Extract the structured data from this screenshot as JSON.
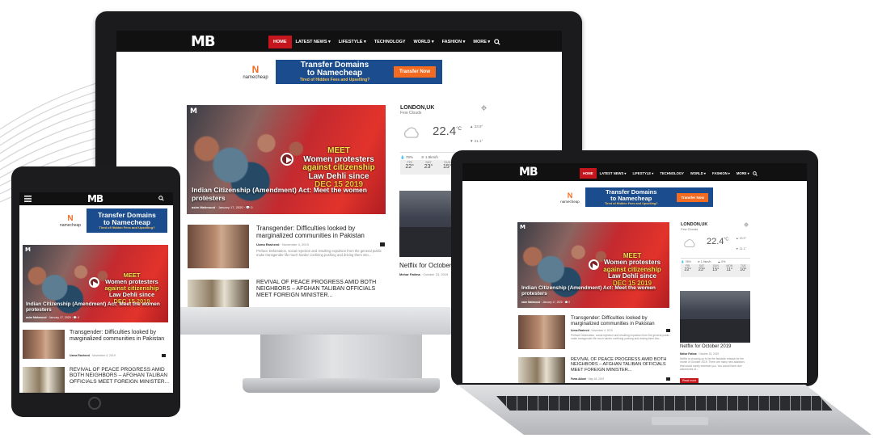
{
  "site": {
    "logo": "MB",
    "nav_desktop": [
      "HOME",
      "LATEST NEWS ▾",
      "LIFESTYLE ▾",
      "TECHNOLOGY",
      "WORLD ▾",
      "FASHION ▾",
      "MORE ▾"
    ],
    "search_icon": "search-icon",
    "menu_icon": "hamburger-icon"
  },
  "ad": {
    "brand_letter": "N",
    "brand_name": "namecheap",
    "line1": "Transfer Domains",
    "line2": "to Namecheap",
    "line3": "Tired of Hidden Fees and Upselling?",
    "button": "Transfer Now"
  },
  "hero": {
    "overlay_line1": "MEET",
    "overlay_line2": "Women protesters",
    "overlay_line3": "against citizenship",
    "overlay_line4": "Law Dehli since",
    "overlay_line5": "DEC 15 2019",
    "title": "Indian Citizenship (Amendment) Act: Meet the women protesters",
    "author": "asim Mahmood",
    "date": "January 17, 2020",
    "comments": "0"
  },
  "posts": [
    {
      "title": "Transgender: Difficulties looked by marginalized communities in Pakistan",
      "author": "Uzma Rasheed",
      "date": "November 4, 2019",
      "excerpt": "Preface Defamation, social rejection and resulting expulsion from the general public make transgender life much harder confining pushing and driving them into..."
    },
    {
      "title": "REVIVAL OF PEACE PROGRESS AMID BOTH NEIGHBORS – AFGHAN TALIBAN OFFICIALS MEET FOREIGN MINISTER...",
      "author": "Faraz Akbari",
      "date": "May 18, 2019",
      "excerpt": ""
    }
  ],
  "weather": {
    "city": "LONDON,UK",
    "condition": "Few Clouds",
    "temp": "22.4",
    "unit": "°C",
    "high": "23.9°",
    "low": "21.1°",
    "humidity": "78%",
    "wind": "1.9km/h",
    "clouds": "0%",
    "days": [
      "FRI",
      "SAT",
      "SUN",
      "MON",
      "TUE"
    ],
    "temps": [
      "22°",
      "23°",
      "15°",
      "11°",
      "10°"
    ]
  },
  "netflix": {
    "title": "Netflix for October 2019",
    "author": "Mehar Fatima",
    "date": "October 23, 2019",
    "excerpt": "Netflix is showing up to be the fantastic release for the month of October 2019. There are many new additions that would surely entertain you. You would have nice adventures of...",
    "read_more": "Read more"
  }
}
